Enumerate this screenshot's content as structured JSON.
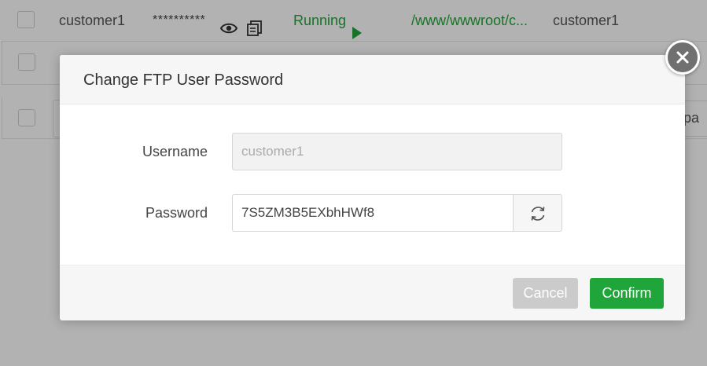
{
  "table": {
    "row1": {
      "name": "customer1",
      "password": "**********",
      "status": "Running",
      "path": "/www/wwwroot/c...",
      "note": "customer1"
    },
    "pager_fragment": "/ pa"
  },
  "dialog": {
    "title": "Change FTP User Password",
    "username_label": "Username",
    "username_value": "customer1",
    "password_label": "Password",
    "password_value": "7S5ZM3B5EXbhHWf8",
    "cancel_label": "Cancel",
    "confirm_label": "Confirm"
  },
  "colors": {
    "accent": "#20a53a",
    "cancel": "#cbcbcb",
    "close_button": "#707070"
  },
  "icons": [
    "eye-icon",
    "copy-icon",
    "play-icon",
    "close-icon",
    "refresh-icon"
  ]
}
